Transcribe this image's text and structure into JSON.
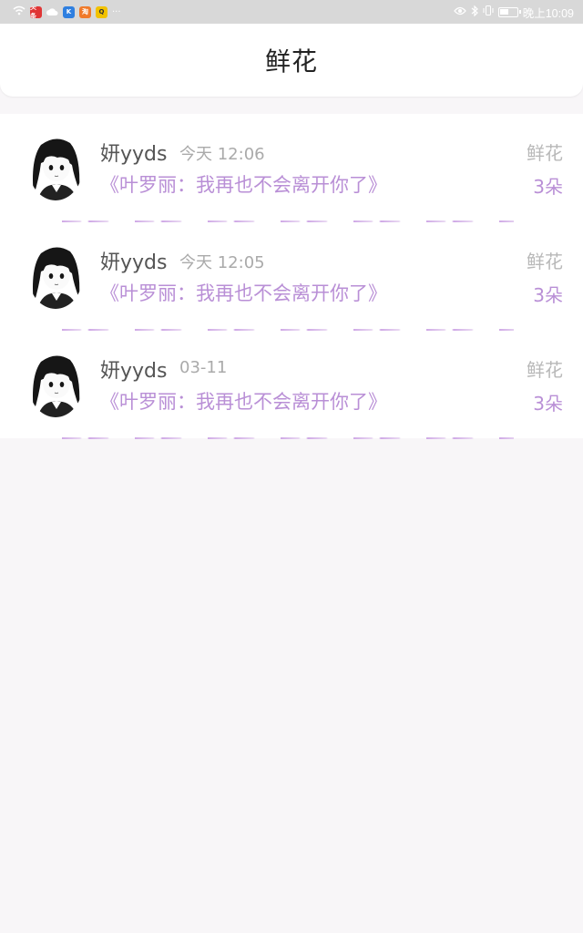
{
  "status_bar": {
    "time": "晚上10:09",
    "app_badges": [
      "头条",
      "云",
      "K",
      "淘",
      "Q",
      "···"
    ]
  },
  "header": {
    "title": "鲜花"
  },
  "items": [
    {
      "name": "妍yyds",
      "time": "今天 12:06",
      "book": "《叶罗丽：我再也不会离开你了》",
      "gift": "鲜花",
      "count": "3朵"
    },
    {
      "name": "妍yyds",
      "time": "今天 12:05",
      "book": "《叶罗丽：我再也不会离开你了》",
      "gift": "鲜花",
      "count": "3朵"
    },
    {
      "name": "妍yyds",
      "time": "03-11",
      "book": "《叶罗丽：我再也不会离开你了》",
      "gift": "鲜花",
      "count": "3朵"
    }
  ],
  "colors": {
    "accent": "#b98fd6",
    "muted": "#aaaaaa",
    "background": "#f8f6f8"
  }
}
